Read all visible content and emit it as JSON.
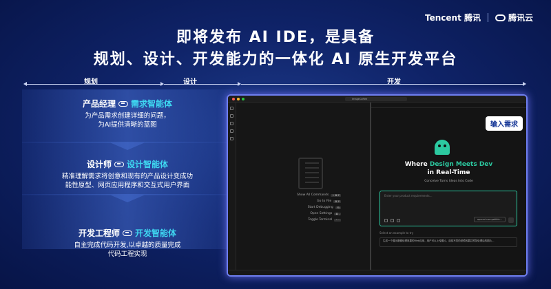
{
  "brand": {
    "tencent": "Tencent 腾讯",
    "cloud": "腾讯云"
  },
  "title": {
    "line1": "即将发布 AI IDE，是具备",
    "line2": "规划、设计、开发能力的一体化 AI 原生开发平台"
  },
  "phases": [
    "规划",
    "设计",
    "开发"
  ],
  "roles": [
    {
      "name": "产品经理",
      "agent": "需求智能体",
      "desc": [
        "为产品需求创建详细的问题，",
        "为AI提供清晰的蓝图"
      ]
    },
    {
      "name": "设计师",
      "agent": "设计智能体",
      "desc": [
        "精准理解需求将创意和现有的产品设计变成功",
        "能性原型、网页应用程序和交互式用户界面"
      ]
    },
    {
      "name": "开发工程师",
      "agent": "开发智能体",
      "desc": [
        "自主完成代码开发,以卓越的质量完成",
        "代码工程实现"
      ]
    }
  ],
  "ide": {
    "search": "ImageCoffee",
    "commands": [
      {
        "label": "Show All Commands",
        "key": "⇧ ⌘ P"
      },
      {
        "label": "Go to File",
        "key": "⌘ P"
      },
      {
        "label": "Start Debugging",
        "key": "F5"
      },
      {
        "label": "Open Settings",
        "key": "⌘ ,"
      },
      {
        "label": "Toggle Terminal",
        "key": "⌃ `"
      }
    ],
    "badge": "输入需求",
    "hero": {
      "pre": "Where ",
      "hl": "Design Meets Dev",
      "line2": "in Real-Time"
    },
    "subtitle": "Conceive Turns Ideas Into Code",
    "input_placeholder": "Enter your product requirements...",
    "model": "openai-compatible...",
    "examples_label": "Select an example to try",
    "example": "生成一个展示图像处理效果的Web应用，用户可以上传图片，选择不同的滤镜效果并预览处理后的图片..."
  }
}
